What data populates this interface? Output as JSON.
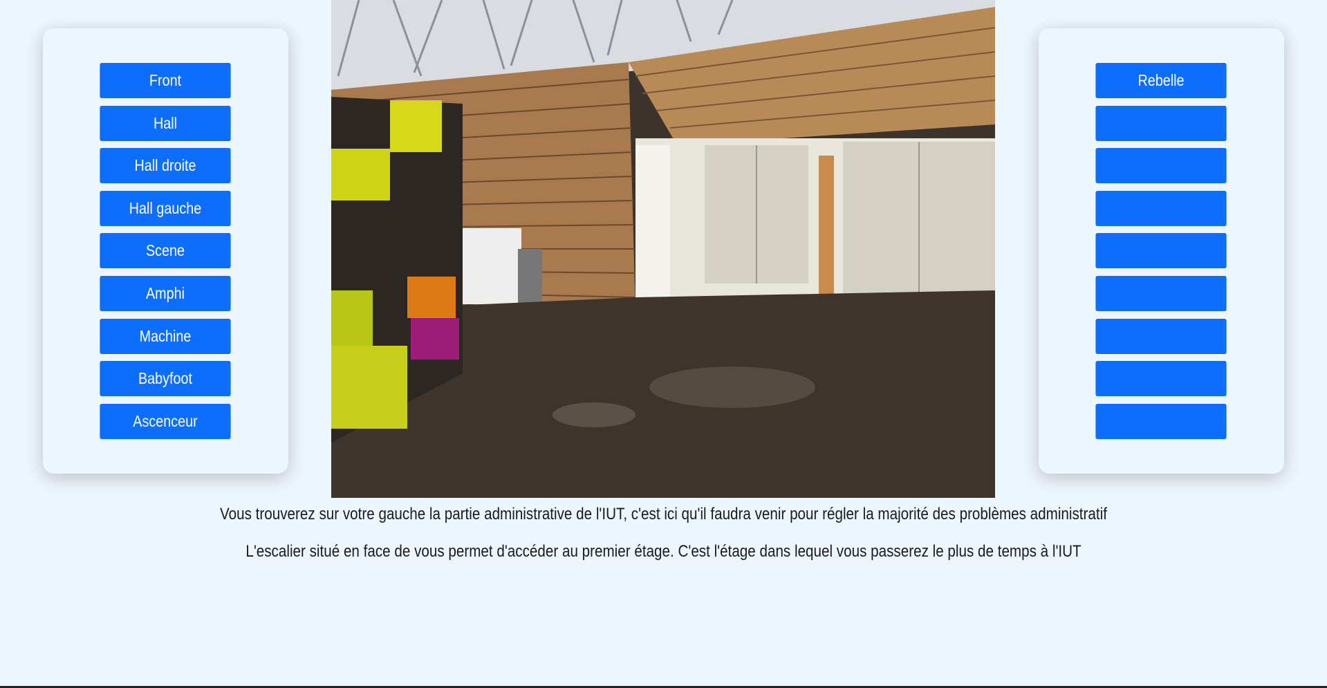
{
  "left_nav": {
    "items": [
      {
        "label": "Front"
      },
      {
        "label": "Hall"
      },
      {
        "label": "Hall droite"
      },
      {
        "label": "Hall gauche"
      },
      {
        "label": "Scene"
      },
      {
        "label": "Amphi"
      },
      {
        "label": "Machine"
      },
      {
        "label": "Babyfoot"
      },
      {
        "label": "Ascenceur"
      }
    ]
  },
  "right_nav": {
    "items": [
      {
        "label": "Rebelle"
      },
      {
        "label": ""
      },
      {
        "label": ""
      },
      {
        "label": ""
      },
      {
        "label": ""
      },
      {
        "label": ""
      },
      {
        "label": ""
      },
      {
        "label": ""
      },
      {
        "label": ""
      }
    ]
  },
  "description": {
    "line1": "Vous trouverez sur votre gauche la partie administrative de l'IUT, c'est ici qu'il faudra venir pour régler la majorité des problèmes administratif",
    "line2": "L'escalier situé en face de vous permet d'accéder au premier étage. C'est l'étage dans lequel vous passerez le plus de temps à l'IUT"
  },
  "colors": {
    "background": "#eef6fd",
    "button": "#0d6efd",
    "button_text": "#ffffff"
  }
}
